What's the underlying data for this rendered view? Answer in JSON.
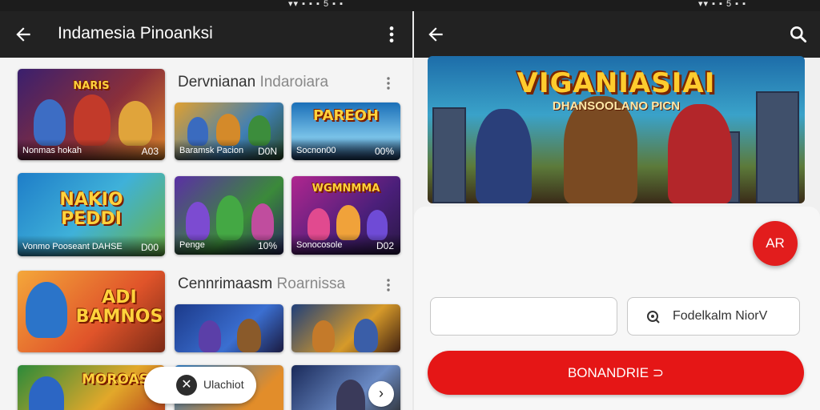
{
  "status_bar": {
    "left_icons": "▾▾ ▪ ▪ ▪ 5 ▪ ▪",
    "right_icons": "▾▾ ▪ ▪ 5 ▪ ▪"
  },
  "left_screen": {
    "title": "Indamesia Pinoanksi",
    "row1": [
      {
        "logo": "NARIS",
        "caption": "Nonmas hokah",
        "number": "A03"
      },
      {
        "logo": "",
        "caption": "Baramsk Pacion",
        "number": "D0N"
      },
      {
        "logo": "PAREOH",
        "caption": "Socnon00",
        "number": "00%"
      }
    ],
    "section1": {
      "title": "Dervnianan",
      "title_light": "Indaroiara"
    },
    "row2": [
      {
        "logo": "NAKIO PEDDI",
        "caption": "Vonmo Pooseant DAHSE",
        "number": "D00"
      },
      {
        "logo": "",
        "caption": "Penge",
        "number": "10%"
      },
      {
        "logo": "WGMNMMA",
        "caption": "Sonocosole",
        "number": "D02"
      }
    ],
    "section2": {
      "title": "Cennrimaasm",
      "title_light": "Roarnissa"
    },
    "row3": [
      {
        "logo": "ADI BAMNOS",
        "caption": "",
        "number": ""
      },
      {
        "logo": "",
        "caption": "",
        "number": ""
      },
      {
        "logo": "",
        "caption": "",
        "number": ""
      }
    ],
    "row4": [
      {
        "logo": "MOROAS"
      },
      {
        "logo": ""
      },
      {
        "logo": ""
      }
    ],
    "floating_pill_label": "Ulachiot",
    "floating_pill_close": "✕",
    "next_symbol": "›"
  },
  "right_screen": {
    "hero": {
      "title": "VIGANIASIAI",
      "tagline": "DHANSOOLANO PICN"
    },
    "fab_label": "AR",
    "input": {
      "value": "",
      "placeholder": ""
    },
    "outline_button_label": "Fodelkalm NiorV",
    "primary_button_label": "BONANDRIE ⊃"
  },
  "colors": {
    "appbar": "#222222",
    "accent_red": "#e51616",
    "background": "#f0f0f0"
  }
}
